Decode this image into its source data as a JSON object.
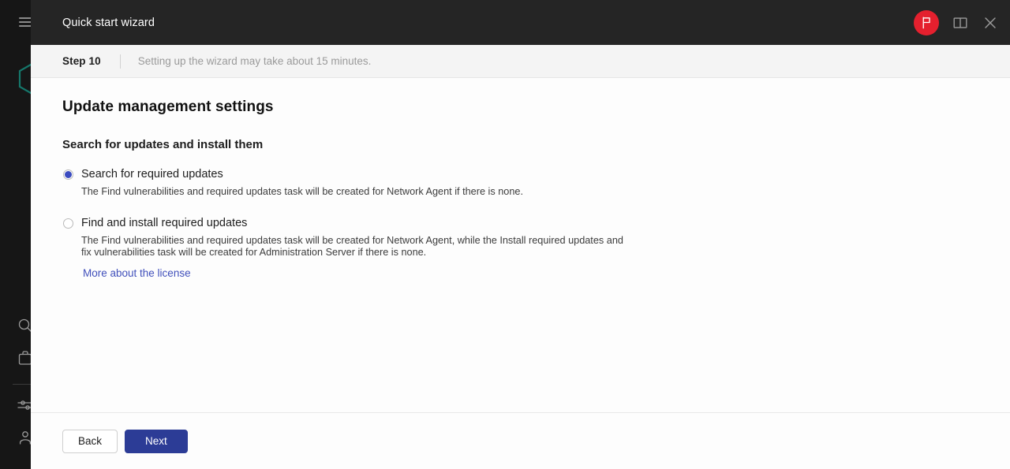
{
  "rail": {
    "menu_icon": "hamburger-icon",
    "logo_icon": "hexagon-logo",
    "icons": [
      {
        "name": "search-icon",
        "label": "Search"
      },
      {
        "name": "briefcase-icon",
        "label": "Assets"
      },
      {
        "name": "sliders-icon",
        "label": "Settings"
      },
      {
        "name": "user-icon",
        "label": "Account"
      }
    ]
  },
  "header": {
    "title": "Quick start wizard",
    "flag_badge_icon": "flag-icon",
    "flag_badge_color": "#e4202e",
    "help_icon": "book-icon",
    "close_icon": "close-icon"
  },
  "step_bar": {
    "step_label": "Step 10",
    "description": "Setting up the wizard may take about 15 minutes."
  },
  "main": {
    "page_title": "Update management settings",
    "section_title": "Search for updates and install them",
    "options": [
      {
        "label": "Search for required updates",
        "description": "The Find vulnerabilities and required updates task will be created for Network Agent if there is none.",
        "selected": true
      },
      {
        "label": "Find and install required updates",
        "description": "The Find vulnerabilities and required updates task will be created for Network Agent, while the Install required updates and fix vulnerabilities task will be created for Administration Server if there is none.",
        "selected": false
      }
    ],
    "license_link": "More about the license"
  },
  "footer": {
    "back_label": "Back",
    "next_label": "Next",
    "next_color": "#2c3c96"
  }
}
